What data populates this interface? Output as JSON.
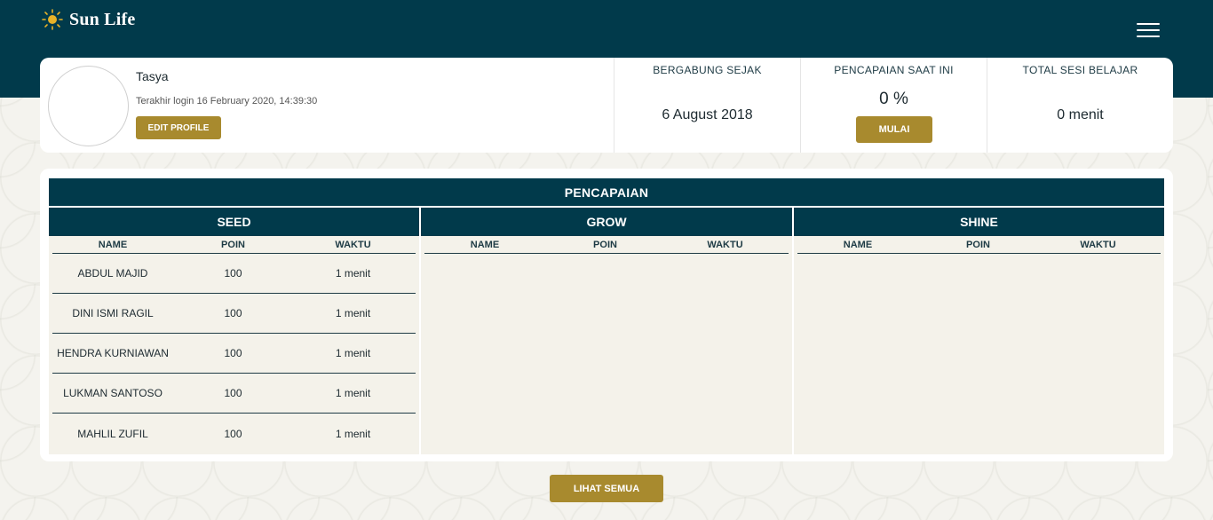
{
  "header": {
    "brand": "Sun Life",
    "menu_icon": "hamburger-menu-icon"
  },
  "profile": {
    "name": "Tasya",
    "last_login": "Terakhir login 16 February 2020, 14:39:30",
    "edit_label": "EDIT PROFILE"
  },
  "stats": {
    "joined_label": "BERGABUNG SEJAK",
    "joined_value": "6 August 2018",
    "achievement_label": "PENCAPAIAN SAAT INI",
    "achievement_value": "0 %",
    "start_label": "MULAI",
    "sessions_label": "TOTAL SESI BELAJAR",
    "sessions_value": "0 menit"
  },
  "achievements": {
    "title": "PENCAPAIAN",
    "columns": [
      "NAME",
      "POIN",
      "WAKTU"
    ],
    "categories": [
      {
        "name": "SEED",
        "rows": [
          {
            "name": "ABDUL MAJID",
            "poin": "100",
            "waktu": "1 menit"
          },
          {
            "name": "DINI ISMI RAGIL",
            "poin": "100",
            "waktu": "1 menit"
          },
          {
            "name": "HENDRA KURNIAWAN",
            "poin": "100",
            "waktu": "1 menit"
          },
          {
            "name": "LUKMAN SANTOSO",
            "poin": "100",
            "waktu": "1 menit"
          },
          {
            "name": "MAHLIL ZUFIL",
            "poin": "100",
            "waktu": "1 menit"
          }
        ]
      },
      {
        "name": "GROW",
        "rows": []
      },
      {
        "name": "SHINE",
        "rows": []
      }
    ]
  },
  "footer": {
    "view_all_label": "LIHAT SEMUA"
  },
  "colors": {
    "primary": "#013a4b",
    "gold": "#a88a2e",
    "panel": "#f4f2ea"
  }
}
